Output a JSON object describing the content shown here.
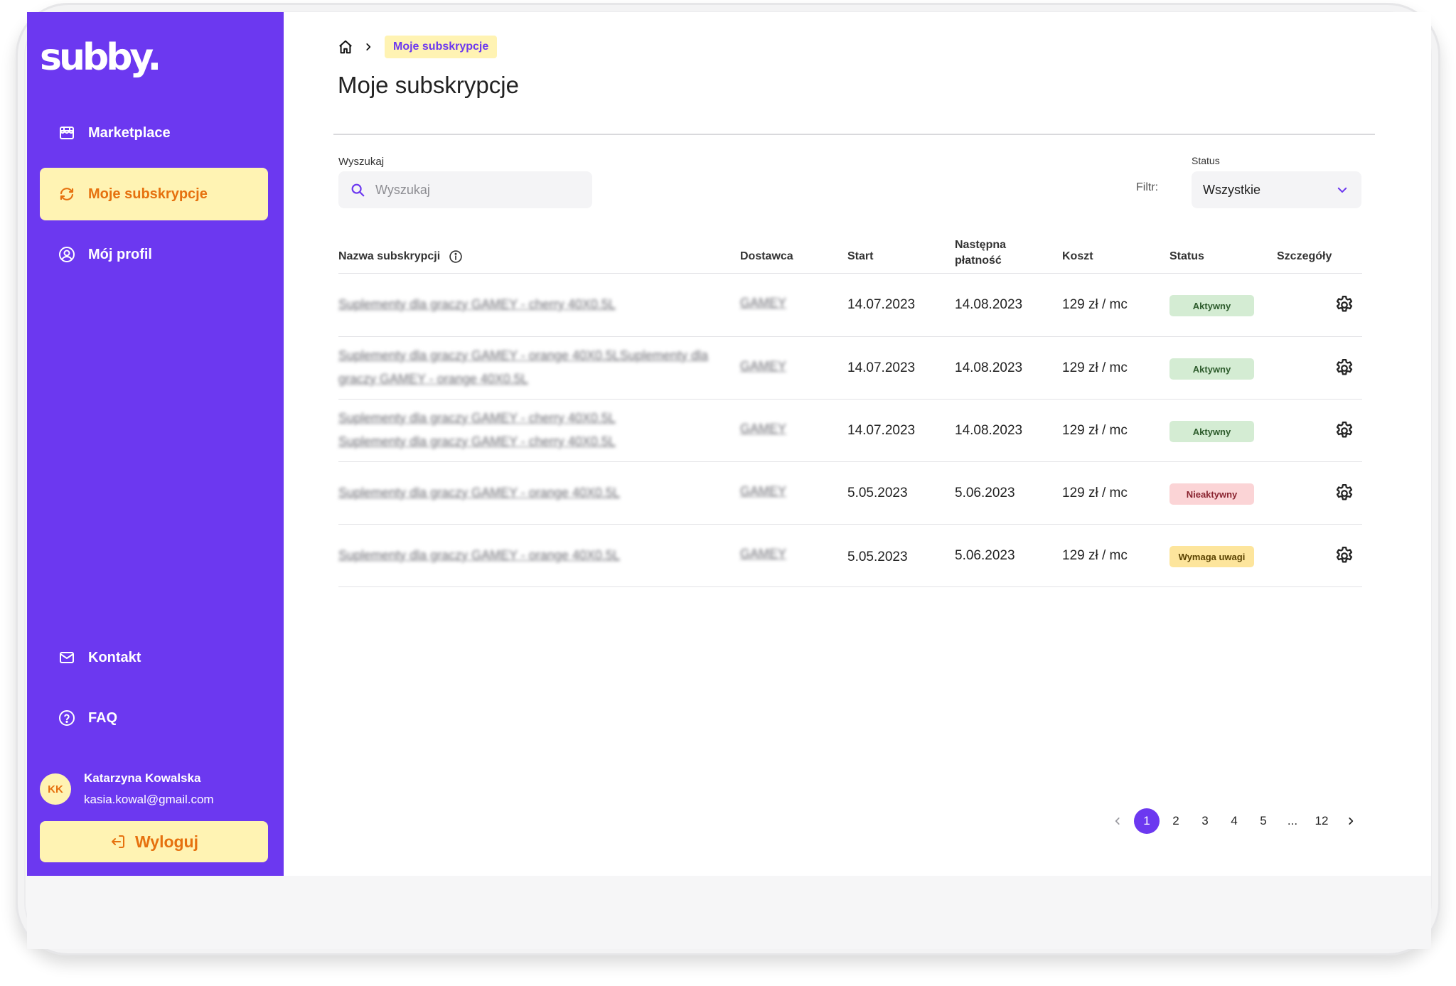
{
  "brand": {
    "logo": "subby."
  },
  "sidebar": {
    "items": [
      {
        "label": "Marketplace",
        "icon": "store-icon"
      },
      {
        "label": "Moje subskrypcje",
        "icon": "refresh-icon",
        "active": true
      },
      {
        "label": "Mój profil",
        "icon": "user-circle-icon"
      }
    ],
    "bottom_items": [
      {
        "label": "Kontakt",
        "icon": "mail-icon"
      },
      {
        "label": "FAQ",
        "icon": "help-circle-icon"
      }
    ],
    "user": {
      "initials": "KK",
      "name": "Katarzyna Kowalska",
      "email": "kasia.kowal@gmail.com"
    },
    "logout_label": "Wyloguj"
  },
  "breadcrumb": {
    "current": "Moje subskrypcje"
  },
  "page": {
    "title": "Moje subskrypcje"
  },
  "search": {
    "label": "Wyszukaj",
    "placeholder": "Wyszukaj",
    "value": ""
  },
  "filter": {
    "label": "Filtr:",
    "status_label": "Status",
    "selected": "Wszystkie"
  },
  "table": {
    "headers": {
      "name": "Nazwa subskrypcji",
      "provider": "Dostawca",
      "start": "Start",
      "next_payment_line1": "Następna",
      "next_payment_line2": "płatność",
      "cost": "Koszt",
      "status": "Status",
      "details": "Szczegóły"
    },
    "rows": [
      {
        "name": "Suplementy dla graczy GAMEY - cherry 40X0.5L",
        "provider": "GAMEY",
        "start": "14.07.2023",
        "next": "14.08.2023",
        "cost": "129 zł / mc",
        "status": "Aktywny",
        "status_type": "active"
      },
      {
        "name": "Suplementy dla graczy GAMEY - orange 40X0.5LSuplementy dla graczy GAMEY - orange 40X0.5L",
        "provider": "GAMEY",
        "start": "14.07.2023",
        "next": "14.08.2023",
        "cost": "129 zł / mc",
        "status": "Aktywny",
        "status_type": "active"
      },
      {
        "name": "Suplementy dla graczy GAMEY - cherry 40X0.5L Suplementy dla graczy GAMEY - cherry 40X0.5L",
        "provider": "GAMEY",
        "start": "14.07.2023",
        "next": "14.08.2023",
        "cost": "129 zł / mc",
        "status": "Aktywny",
        "status_type": "active"
      },
      {
        "name": "Suplementy dla graczy GAMEY - orange 40X0.5L",
        "provider": "GAMEY",
        "start": "5.05.2023",
        "next": "5.06.2023",
        "cost": "129 zł / mc",
        "status": "Nieaktywny",
        "status_type": "inactive"
      },
      {
        "name": "Suplementy dla graczy GAMEY - orange 40X0.5L",
        "provider": "GAMEY",
        "start": "5.05.2023",
        "next": "5.06.2023",
        "cost": "129 zł / mc",
        "status": "Wymaga uwagi",
        "status_type": "warning"
      }
    ]
  },
  "pagination": {
    "pages": [
      "1",
      "2",
      "3",
      "4",
      "5",
      "...",
      "12"
    ],
    "current": "1"
  },
  "colors": {
    "brand": "#6c38f0",
    "highlight": "#fff3b3",
    "accent_text": "#e6710f"
  }
}
